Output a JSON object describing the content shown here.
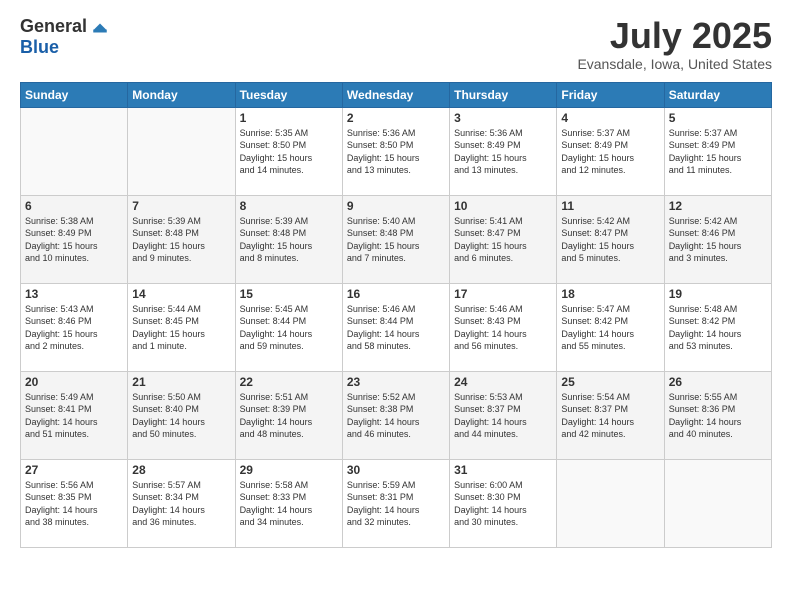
{
  "logo": {
    "general": "General",
    "blue": "Blue"
  },
  "title": "July 2025",
  "location": "Evansdale, Iowa, United States",
  "days_of_week": [
    "Sunday",
    "Monday",
    "Tuesday",
    "Wednesday",
    "Thursday",
    "Friday",
    "Saturday"
  ],
  "weeks": [
    [
      {
        "day": "",
        "detail": ""
      },
      {
        "day": "",
        "detail": ""
      },
      {
        "day": "1",
        "detail": "Sunrise: 5:35 AM\nSunset: 8:50 PM\nDaylight: 15 hours\nand 14 minutes."
      },
      {
        "day": "2",
        "detail": "Sunrise: 5:36 AM\nSunset: 8:50 PM\nDaylight: 15 hours\nand 13 minutes."
      },
      {
        "day": "3",
        "detail": "Sunrise: 5:36 AM\nSunset: 8:49 PM\nDaylight: 15 hours\nand 13 minutes."
      },
      {
        "day": "4",
        "detail": "Sunrise: 5:37 AM\nSunset: 8:49 PM\nDaylight: 15 hours\nand 12 minutes."
      },
      {
        "day": "5",
        "detail": "Sunrise: 5:37 AM\nSunset: 8:49 PM\nDaylight: 15 hours\nand 11 minutes."
      }
    ],
    [
      {
        "day": "6",
        "detail": "Sunrise: 5:38 AM\nSunset: 8:49 PM\nDaylight: 15 hours\nand 10 minutes."
      },
      {
        "day": "7",
        "detail": "Sunrise: 5:39 AM\nSunset: 8:48 PM\nDaylight: 15 hours\nand 9 minutes."
      },
      {
        "day": "8",
        "detail": "Sunrise: 5:39 AM\nSunset: 8:48 PM\nDaylight: 15 hours\nand 8 minutes."
      },
      {
        "day": "9",
        "detail": "Sunrise: 5:40 AM\nSunset: 8:48 PM\nDaylight: 15 hours\nand 7 minutes."
      },
      {
        "day": "10",
        "detail": "Sunrise: 5:41 AM\nSunset: 8:47 PM\nDaylight: 15 hours\nand 6 minutes."
      },
      {
        "day": "11",
        "detail": "Sunrise: 5:42 AM\nSunset: 8:47 PM\nDaylight: 15 hours\nand 5 minutes."
      },
      {
        "day": "12",
        "detail": "Sunrise: 5:42 AM\nSunset: 8:46 PM\nDaylight: 15 hours\nand 3 minutes."
      }
    ],
    [
      {
        "day": "13",
        "detail": "Sunrise: 5:43 AM\nSunset: 8:46 PM\nDaylight: 15 hours\nand 2 minutes."
      },
      {
        "day": "14",
        "detail": "Sunrise: 5:44 AM\nSunset: 8:45 PM\nDaylight: 15 hours\nand 1 minute."
      },
      {
        "day": "15",
        "detail": "Sunrise: 5:45 AM\nSunset: 8:44 PM\nDaylight: 14 hours\nand 59 minutes."
      },
      {
        "day": "16",
        "detail": "Sunrise: 5:46 AM\nSunset: 8:44 PM\nDaylight: 14 hours\nand 58 minutes."
      },
      {
        "day": "17",
        "detail": "Sunrise: 5:46 AM\nSunset: 8:43 PM\nDaylight: 14 hours\nand 56 minutes."
      },
      {
        "day": "18",
        "detail": "Sunrise: 5:47 AM\nSunset: 8:42 PM\nDaylight: 14 hours\nand 55 minutes."
      },
      {
        "day": "19",
        "detail": "Sunrise: 5:48 AM\nSunset: 8:42 PM\nDaylight: 14 hours\nand 53 minutes."
      }
    ],
    [
      {
        "day": "20",
        "detail": "Sunrise: 5:49 AM\nSunset: 8:41 PM\nDaylight: 14 hours\nand 51 minutes."
      },
      {
        "day": "21",
        "detail": "Sunrise: 5:50 AM\nSunset: 8:40 PM\nDaylight: 14 hours\nand 50 minutes."
      },
      {
        "day": "22",
        "detail": "Sunrise: 5:51 AM\nSunset: 8:39 PM\nDaylight: 14 hours\nand 48 minutes."
      },
      {
        "day": "23",
        "detail": "Sunrise: 5:52 AM\nSunset: 8:38 PM\nDaylight: 14 hours\nand 46 minutes."
      },
      {
        "day": "24",
        "detail": "Sunrise: 5:53 AM\nSunset: 8:37 PM\nDaylight: 14 hours\nand 44 minutes."
      },
      {
        "day": "25",
        "detail": "Sunrise: 5:54 AM\nSunset: 8:37 PM\nDaylight: 14 hours\nand 42 minutes."
      },
      {
        "day": "26",
        "detail": "Sunrise: 5:55 AM\nSunset: 8:36 PM\nDaylight: 14 hours\nand 40 minutes."
      }
    ],
    [
      {
        "day": "27",
        "detail": "Sunrise: 5:56 AM\nSunset: 8:35 PM\nDaylight: 14 hours\nand 38 minutes."
      },
      {
        "day": "28",
        "detail": "Sunrise: 5:57 AM\nSunset: 8:34 PM\nDaylight: 14 hours\nand 36 minutes."
      },
      {
        "day": "29",
        "detail": "Sunrise: 5:58 AM\nSunset: 8:33 PM\nDaylight: 14 hours\nand 34 minutes."
      },
      {
        "day": "30",
        "detail": "Sunrise: 5:59 AM\nSunset: 8:31 PM\nDaylight: 14 hours\nand 32 minutes."
      },
      {
        "day": "31",
        "detail": "Sunrise: 6:00 AM\nSunset: 8:30 PM\nDaylight: 14 hours\nand 30 minutes."
      },
      {
        "day": "",
        "detail": ""
      },
      {
        "day": "",
        "detail": ""
      }
    ]
  ]
}
